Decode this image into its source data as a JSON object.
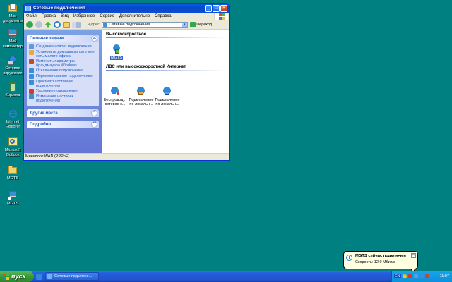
{
  "desktop": {
    "icons": [
      {
        "label": "Мои документы",
        "icon": "my-documents-icon"
      },
      {
        "label": "Мой компьютер",
        "icon": "my-computer-icon"
      },
      {
        "label": "Сетевое окружение",
        "icon": "network-places-icon"
      },
      {
        "label": "Корзина",
        "icon": "recycle-bin-icon"
      },
      {
        "label": "Internet Explorer",
        "icon": "internet-explorer-icon"
      },
      {
        "label": "Microsoft Outlook",
        "icon": "outlook-icon"
      },
      {
        "label": "MGTS",
        "icon": "folder-icon"
      },
      {
        "label": "MGTS",
        "icon": "shortcut-icon"
      }
    ]
  },
  "window": {
    "title": "Сетевые подключения",
    "menu": [
      "Файл",
      "Правка",
      "Вид",
      "Избранное",
      "Сервис",
      "Дополнительно",
      "Справка"
    ],
    "address_label": "Адрес:",
    "address_value": "Сетевые подключения",
    "go_label": "Переход",
    "taskpane": {
      "network_tasks_title": "Сетевые задачи",
      "network_tasks": [
        "Создание нового подключения",
        "Установить домашнюю сеть или сеть малого офиса",
        "Изменить параметры брандмауэра Windows",
        "Отключение подключения",
        "Переименование подключения",
        "Просмотр состояния подключения",
        "Удаление подключения",
        "Изменение настроек подключения"
      ],
      "other_places_title": "Другие места",
      "details_title": "Подробно"
    },
    "groups": {
      "broadband_title": "Высокоскоростное",
      "broadband_items": [
        "MGTS"
      ],
      "lan_title": "ЛВС или высокоскоростной Интернет",
      "lan_items": [
        "Беспровод... сетевое с...",
        "Подключение по локальн...",
        "Подключение по локальн..."
      ]
    },
    "status_text": "Минипорт WAN (PPPoE)"
  },
  "taskbar": {
    "start_label": "пуск",
    "task_label": "Сетевые подключе...",
    "lang": "EN",
    "clock": "11:07"
  },
  "balloon": {
    "title": "MGTS сейчас подключен",
    "body": "Скорость: 12.0 Мбит/с",
    "close": "×"
  },
  "colors": {
    "desktop": "#008080",
    "xp_blue": "#0a5ee8",
    "taskpane_link": "#215dc6",
    "start_green": "#3a9a3a"
  }
}
